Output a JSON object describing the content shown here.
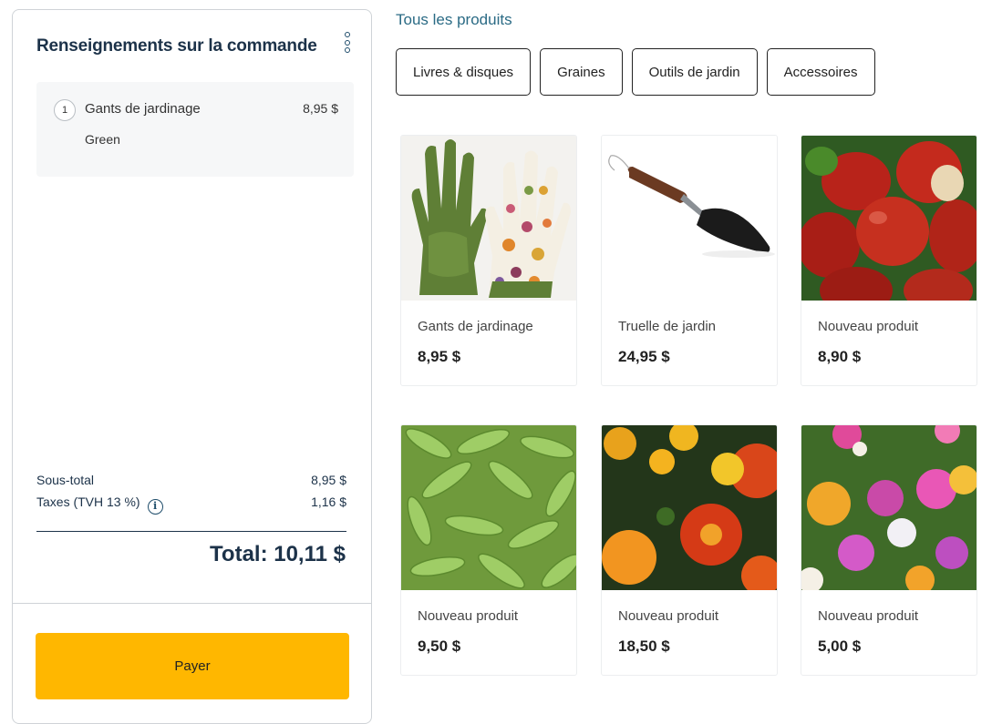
{
  "order": {
    "title": "Renseignements sur la commande",
    "menu_icon": "vertical-dots-icon",
    "items": [
      {
        "quantity": "1",
        "name": "Gants de jardinage",
        "price": "8,95 $",
        "variant": "Green"
      }
    ],
    "subtotal_label": "Sous-total",
    "subtotal_value": "8,95 $",
    "tax_label": "Taxes (TVH 13 %)",
    "tax_icon": "info-icon",
    "tax_value": "1,16 $",
    "total": "Total: 10,11 $",
    "pay_label": "Payer"
  },
  "catalog": {
    "all_products_link": "Tous les produits",
    "categories": [
      "Livres & disques",
      "Graines",
      "Outils de jardin",
      "Accessoires"
    ],
    "products": [
      {
        "name": "Gants de jardinage",
        "price": "8,95 $"
      },
      {
        "name": "Truelle de jardin",
        "price": "24,95 $"
      },
      {
        "name": "Nouveau produit",
        "price": "8,90 $"
      },
      {
        "name": "Nouveau produit",
        "price": "9,50 $"
      },
      {
        "name": "Nouveau produit",
        "price": "18,50 $"
      },
      {
        "name": "Nouveau produit",
        "price": "5,00 $"
      }
    ]
  },
  "colors": {
    "accent": "#ffb700",
    "heading": "#1c3249",
    "link": "#2b6b85"
  }
}
